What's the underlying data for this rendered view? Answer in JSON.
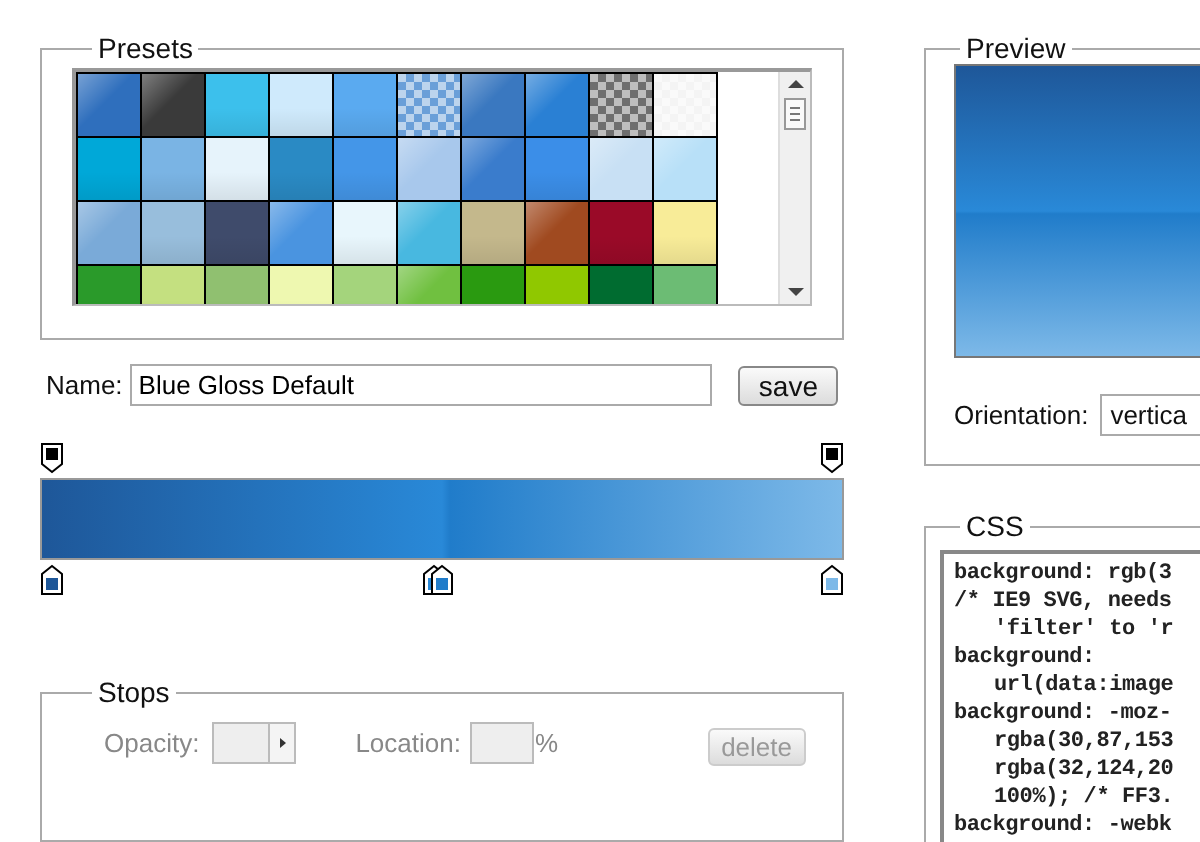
{
  "presets": {
    "legend": "Presets",
    "swatches": [
      {
        "color": "#2f6fbd",
        "kind": "gloss"
      },
      {
        "color": "#3a3a3a",
        "kind": "gloss"
      },
      {
        "color": "#3cc0ec",
        "kind": "flat"
      },
      {
        "color": "#cfeafc",
        "kind": "flat"
      },
      {
        "color": "#5aaaf0",
        "kind": "flat"
      },
      {
        "color": "#6a9fd8",
        "kind": "checker"
      },
      {
        "color": "#3a78c0",
        "kind": "gloss"
      },
      {
        "color": "#2a80d4",
        "kind": "gloss"
      },
      {
        "color": "#6e6e6e",
        "kind": "checker"
      },
      {
        "color": "#f4f4f4",
        "kind": "checker"
      },
      {
        "color": "#00a8d8",
        "kind": "flat"
      },
      {
        "color": "#7ab4e4",
        "kind": "flat"
      },
      {
        "color": "#e6f3fb",
        "kind": "flat"
      },
      {
        "color": "#2a8ac4",
        "kind": "flat"
      },
      {
        "color": "#4496e8",
        "kind": "flat"
      },
      {
        "color": "#a8c8ec",
        "kind": "gloss"
      },
      {
        "color": "#3a7ccc",
        "kind": "gloss"
      },
      {
        "color": "#3b8ee8",
        "kind": "flat"
      },
      {
        "color": "#c8e0f4",
        "kind": "gloss"
      },
      {
        "color": "#b8e0f8",
        "kind": "gloss"
      },
      {
        "color": "#7aaad8",
        "kind": "gloss"
      },
      {
        "color": "#98bedc",
        "kind": "flat"
      },
      {
        "color": "#3f4b6b",
        "kind": "flat"
      },
      {
        "color": "#4a94e0",
        "kind": "gloss"
      },
      {
        "color": "#e8f6fc",
        "kind": "flat"
      },
      {
        "color": "#48b8e0",
        "kind": "gloss"
      },
      {
        "color": "#c4b88c",
        "kind": "flat"
      },
      {
        "color": "#a04a20",
        "kind": "gloss"
      },
      {
        "color": "#9a0a28",
        "kind": "flat"
      },
      {
        "color": "#f8ec98",
        "kind": "flat"
      },
      {
        "color": "#2a9a2a",
        "kind": "flat"
      },
      {
        "color": "#c4e080",
        "kind": "flat"
      },
      {
        "color": "#90c070",
        "kind": "flat"
      },
      {
        "color": "#eef8b0",
        "kind": "flat"
      },
      {
        "color": "#a4d47c",
        "kind": "flat"
      },
      {
        "color": "#70c040",
        "kind": "gloss"
      },
      {
        "color": "#2a9a10",
        "kind": "flat"
      },
      {
        "color": "#90c800",
        "kind": "flat"
      },
      {
        "color": "#006c30",
        "kind": "flat"
      },
      {
        "color": "#6cbc74",
        "kind": "flat"
      }
    ]
  },
  "name_row": {
    "label": "Name:",
    "value": "Blue Gloss Default",
    "button": "save"
  },
  "opacity_stops": [
    {
      "color": "#000000"
    },
    {
      "color": "#000000"
    }
  ],
  "color_stops": {
    "start": {
      "color": "#1e5799"
    },
    "middle": [
      {
        "color": "#2989d8"
      },
      {
        "color": "#207cca"
      }
    ],
    "end": {
      "color": "#7db9e8"
    }
  },
  "stops": {
    "legend": "Stops",
    "opacity_label": "Opacity:",
    "location_label": "Location:",
    "percent": "%",
    "delete": "delete",
    "disabled": true
  },
  "preview": {
    "legend": "Preview",
    "orientation_label": "Orientation:",
    "orientation": "vertica"
  },
  "css": {
    "legend": "CSS",
    "lines": [
      {
        "text": "background: rgb(3",
        "indented": false
      },
      {
        "text": "/* IE9 SVG, needs",
        "indented": false
      },
      {
        "text": "'filter' to 'r",
        "indented": true
      },
      {
        "text": "background:",
        "indented": false
      },
      {
        "text": "url(data:image",
        "indented": true
      },
      {
        "text": "background: -moz-",
        "indented": false
      },
      {
        "text": "rgba(30,87,153",
        "indented": true
      },
      {
        "text": "rgba(32,124,20",
        "indented": true
      },
      {
        "text": "100%); /* FF3.",
        "indented": true
      },
      {
        "text": "background: -webk",
        "indented": false
      }
    ]
  }
}
